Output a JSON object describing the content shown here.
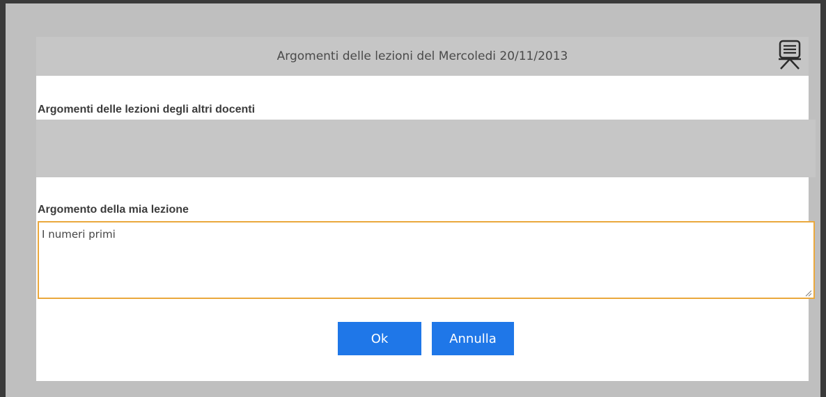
{
  "dialog": {
    "title": "Argomenti delle lezioni del  Mercoledi 20/11/2013",
    "header_icon": "presentation-board-icon"
  },
  "others": {
    "label": "Argomenti delle lezioni degli altri docenti",
    "content": ""
  },
  "mine": {
    "label": "Argomento della mia lezione",
    "value": "I numeri primi"
  },
  "buttons": {
    "ok_label": "Ok",
    "cancel_label": "Annulla"
  },
  "colors": {
    "accent": "#1f77e8",
    "focus_border": "#eaa83c",
    "header_bg": "#c6c6c6"
  }
}
